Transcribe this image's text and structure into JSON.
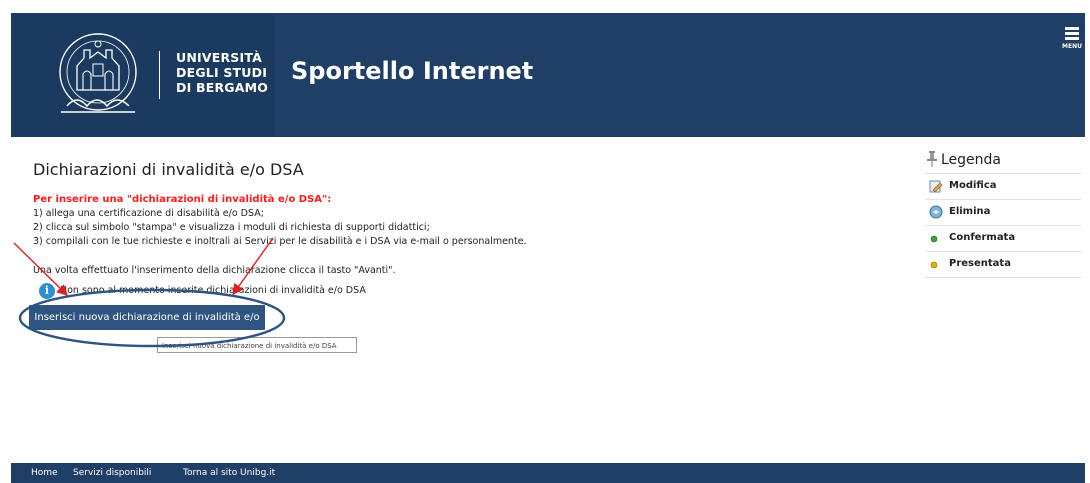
{
  "header": {
    "logo_lines": [
      "UNIVERSITÀ",
      "DEGLI STUDI",
      "DI BERGAMO"
    ],
    "app_title": "Sportello Internet",
    "menu_label": "MENU"
  },
  "main": {
    "page_title": "Dichiarazioni di invalidità e/o DSA",
    "instructions_heading": "Per inserire una \"dichiarazioni di invalidità e/o DSA\":",
    "instructions": [
      "1) allega una certificazione di disabilità e/o DSA;",
      "2) clicca sul simbolo \"stampa\" e visualizza i moduli di richiesta di supporti didattici;",
      "3) compilali con le tue richieste e inoltrali ai Servizi per le disabilità e i DSA via e-mail o personalmente."
    ],
    "after_note": "Una volta effettuato l'inserimento della dichiarazione clicca il tasto \"Avanti\".",
    "info_message": "Non sono al momento inserite dichiarazioni di invalidità e/o DSA",
    "insert_button": "Inserisci nuova dichiarazione di invalidità e/o DSA",
    "tooltip": "Inserisci nuova dichiarazione di invalidità e/o DSA"
  },
  "legend": {
    "title": "Legenda",
    "items": [
      {
        "label": "Modifica",
        "icon": "edit-icon"
      },
      {
        "label": "Elimina",
        "icon": "delete-icon"
      },
      {
        "label": "Confermata",
        "icon": "green-dot-icon",
        "color": "#3aa63a"
      },
      {
        "label": "Presentata",
        "icon": "yellow-dot-icon",
        "color": "#e0b400"
      }
    ]
  },
  "footer": {
    "links": [
      "Home",
      "Servizi disponibili",
      "Torna al sito Unibg.it"
    ]
  },
  "colors": {
    "header_bg": "#1f3f66",
    "button_bg": "#2e557f",
    "instructions_heading": "#ff1a1a",
    "annotation_arrow": "#e02020",
    "annotation_ellipse": "#2e557f"
  }
}
